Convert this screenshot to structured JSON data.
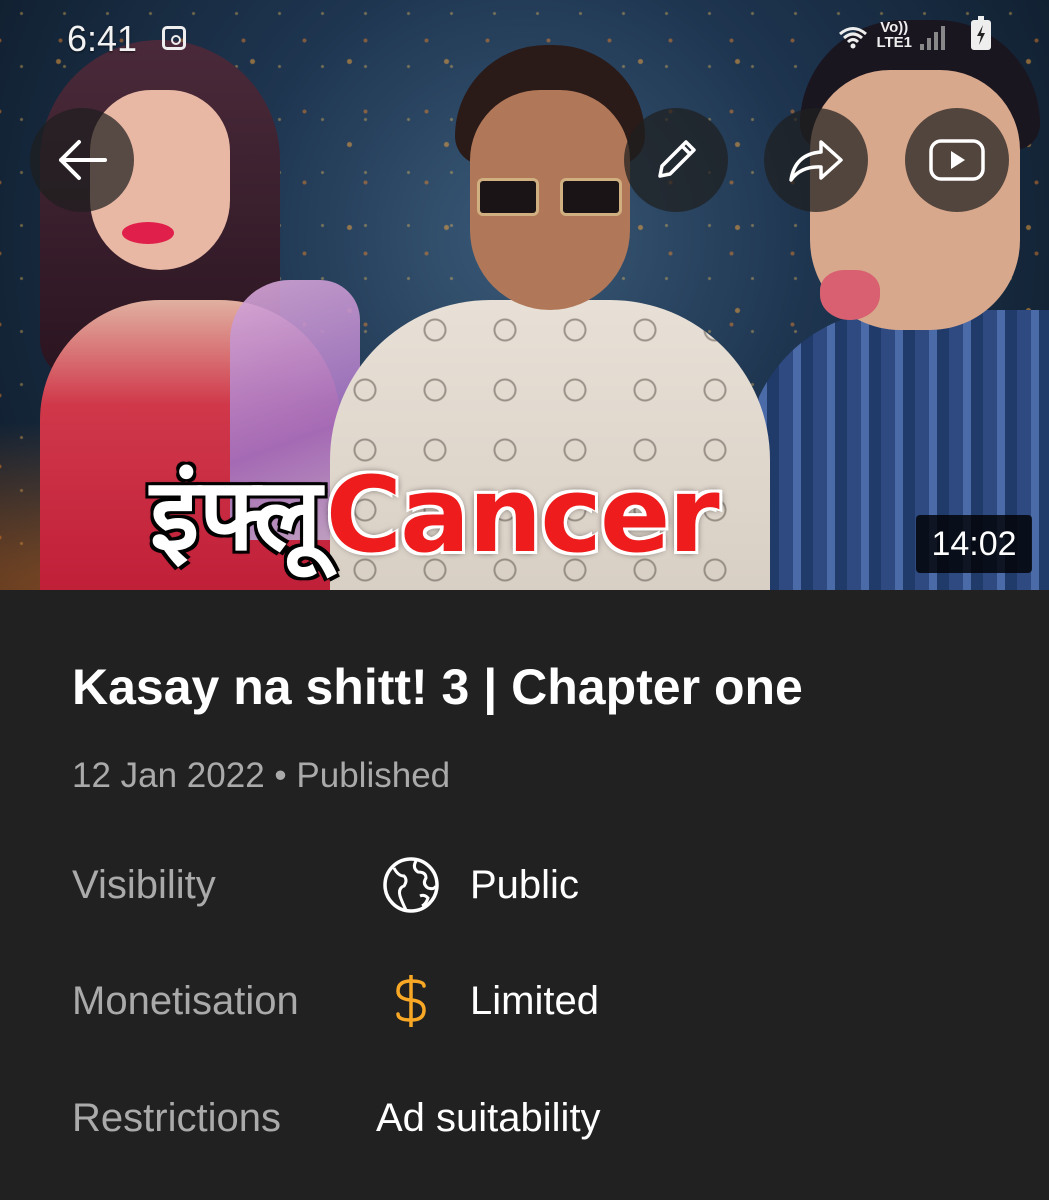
{
  "status_bar": {
    "time": "6:41",
    "network_top": "Vo))",
    "network_bottom": "LTE1"
  },
  "video": {
    "thumbnail_title_hindi": "इंफ्लू",
    "thumbnail_title_english": "Cancer",
    "duration": "14:02",
    "title": "Kasay na shitt! 3 | Chapter one",
    "date": "12 Jan 2022",
    "separator": "•",
    "status": "Published"
  },
  "toolbar": {
    "back_icon": "arrow-left-icon",
    "edit_icon": "pencil-icon",
    "share_icon": "share-arrow-icon",
    "play_icon": "youtube-play-icon"
  },
  "details": {
    "visibility_label": "Visibility",
    "visibility_value": "Public",
    "visibility_icon": "globe-icon",
    "monetisation_label": "Monetisation",
    "monetisation_value": "Limited",
    "monetisation_icon": "dollar-icon",
    "monetisation_color": "#f9a825",
    "restrictions_label": "Restrictions",
    "restrictions_value": "Ad suitability"
  },
  "colors": {
    "background": "#212121",
    "secondary_text": "#aaaaaa",
    "thumbnail_red": "#ee1c1c"
  }
}
